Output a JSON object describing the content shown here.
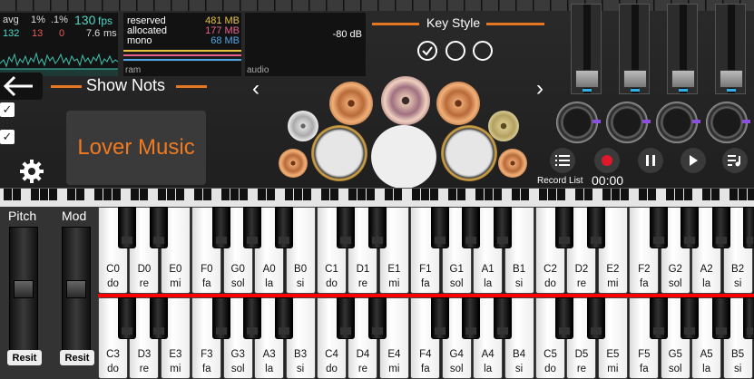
{
  "fps_stats": {
    "avg_label": "avg",
    "p1_label": "1%",
    "p01_label": ".1%",
    "fps_value": "130",
    "fps_unit": "fps",
    "avg_value": "132",
    "p1_value": "13",
    "p01_value": "0",
    "ms_value": "7.6",
    "ms_unit": "ms"
  },
  "memory": {
    "reserved_label": "reserved",
    "reserved_value": "481 MB",
    "allocated_label": "allocated",
    "allocated_value": "177 MB",
    "mono_label": "mono",
    "mono_value": "68 MB",
    "ram_label": "ram"
  },
  "audio": {
    "level": "-80 dB",
    "label": "audio"
  },
  "key_style": {
    "title": "Key Style"
  },
  "show_nots": {
    "label": "Show Nots",
    "back_icon": "arrow-left-icon"
  },
  "song": {
    "title": "Lover Music"
  },
  "nav": {
    "prev_icon": "‹",
    "next_icon": "›"
  },
  "record": {
    "list_label": "Record List",
    "time": "00:00"
  },
  "wheels": {
    "pitch_label": "Pitch",
    "mod_label": "Mod",
    "pitch_reset": "Resit",
    "mod_reset": "Resit"
  },
  "colors": {
    "accent": "#e57722",
    "song_title": "#f07a1f",
    "record": "#e0182a",
    "divider": "#ff0000",
    "fader_led": "#2fb0e8",
    "knob_indicator": "#8a4fe0"
  },
  "keyboard": {
    "upper": [
      {
        "note": "C0",
        "solfege": "do"
      },
      {
        "note": "D0",
        "solfege": "re"
      },
      {
        "note": "E0",
        "solfege": "mi"
      },
      {
        "note": "F0",
        "solfege": "fa"
      },
      {
        "note": "G0",
        "solfege": "sol"
      },
      {
        "note": "A0",
        "solfege": "la"
      },
      {
        "note": "B0",
        "solfege": "si"
      },
      {
        "note": "C1",
        "solfege": "do"
      },
      {
        "note": "D1",
        "solfege": "re"
      },
      {
        "note": "E1",
        "solfege": "mi"
      },
      {
        "note": "F1",
        "solfege": "fa"
      },
      {
        "note": "G1",
        "solfege": "sol"
      },
      {
        "note": "A1",
        "solfege": "la"
      },
      {
        "note": "B1",
        "solfege": "si"
      },
      {
        "note": "C2",
        "solfege": "do"
      },
      {
        "note": "D2",
        "solfege": "re"
      },
      {
        "note": "E2",
        "solfege": "mi"
      },
      {
        "note": "F2",
        "solfege": "fa"
      },
      {
        "note": "G2",
        "solfege": "sol"
      },
      {
        "note": "A2",
        "solfege": "la"
      },
      {
        "note": "B2",
        "solfege": "si"
      }
    ],
    "lower": [
      {
        "note": "C3",
        "solfege": "do"
      },
      {
        "note": "D3",
        "solfege": "re"
      },
      {
        "note": "E3",
        "solfege": "mi"
      },
      {
        "note": "F3",
        "solfege": "fa"
      },
      {
        "note": "G3",
        "solfege": "sol"
      },
      {
        "note": "A3",
        "solfege": "la"
      },
      {
        "note": "B3",
        "solfege": "si"
      },
      {
        "note": "C4",
        "solfege": "do"
      },
      {
        "note": "D4",
        "solfege": "re"
      },
      {
        "note": "E4",
        "solfege": "mi"
      },
      {
        "note": "F4",
        "solfege": "fa"
      },
      {
        "note": "G4",
        "solfege": "sol"
      },
      {
        "note": "A4",
        "solfege": "la"
      },
      {
        "note": "B4",
        "solfege": "si"
      },
      {
        "note": "C5",
        "solfege": "do"
      },
      {
        "note": "D5",
        "solfege": "re"
      },
      {
        "note": "E5",
        "solfege": "mi"
      },
      {
        "note": "F5",
        "solfege": "fa"
      },
      {
        "note": "G5",
        "solfege": "sol"
      },
      {
        "note": "A5",
        "solfege": "la"
      },
      {
        "note": "B5",
        "solfege": "si"
      }
    ]
  }
}
